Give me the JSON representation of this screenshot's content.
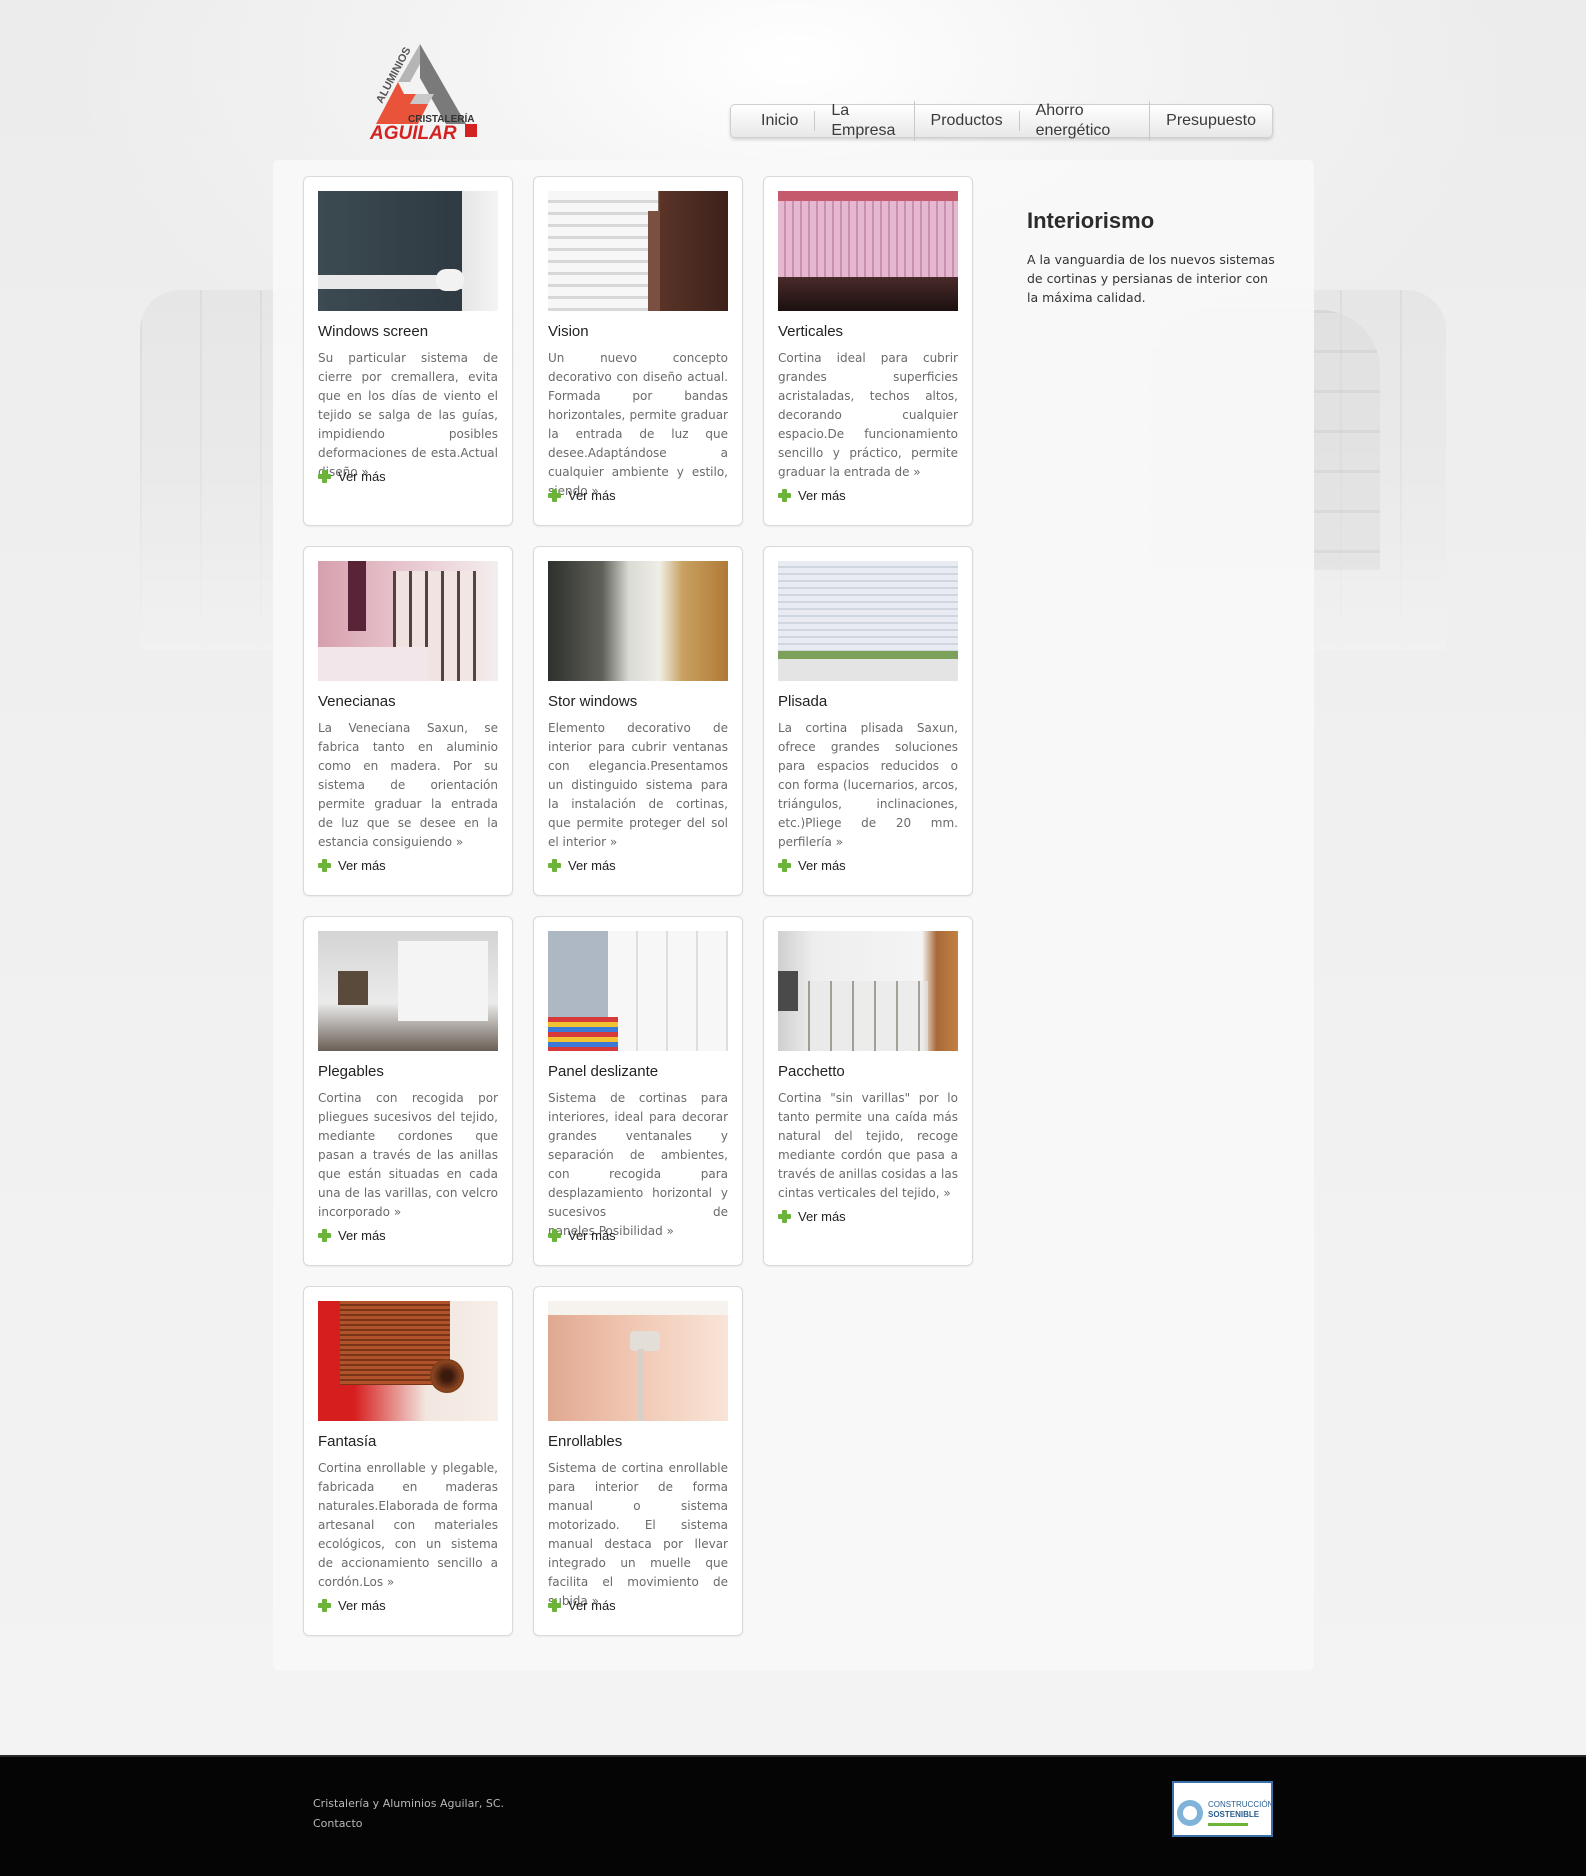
{
  "logo": {
    "line1": "ALUMINIOS",
    "line2": "CRISTALERÍA",
    "line3": "AGUILAR"
  },
  "nav": {
    "items": [
      "Inicio",
      "La Empresa",
      "Productos",
      "Ahorro energético",
      "Presupuesto"
    ]
  },
  "sidebar": {
    "title": "Interiorismo",
    "text": "A la vanguardia de los nuevos sistemas de cortinas y persianas de interior con la máxima calidad."
  },
  "more_label": "Ver más",
  "products": [
    {
      "title": "Windows screen",
      "text": "Su particular sistema de cierre por cremallera, evita que en los días de viento el tejido se salga de las guías, impidiendo posibles deformaciones de esta.Actual diseño »"
    },
    {
      "title": "Vision",
      "text": "Un nuevo concepto decorativo con diseño actual. Formada por bandas horizontales, permite graduar la entrada de luz que desee.Adaptándose a cualquier ambiente y estilo, siendo »"
    },
    {
      "title": "Verticales",
      "text": "Cortina ideal para cubrir grandes superficies acristaladas, techos altos, decorando cualquier espacio.De funcionamiento sencillo y práctico, permite graduar la entrada de »"
    },
    {
      "title": "Venecianas",
      "text": "La Veneciana Saxun, se fabrica tanto en aluminio como en madera. Por su sistema de orientación permite graduar la entrada de luz que se desee en la estancia consiguiendo »"
    },
    {
      "title": "Stor windows",
      "text": "Elemento decorativo de interior para cubrir ventanas con elegancia.Presentamos un distinguido sistema para la instalación de cortinas, que permite proteger del sol el interior »"
    },
    {
      "title": "Plisada",
      "text": "La cortina plisada Saxun, ofrece grandes soluciones para espacios reducidos o con forma (lucernarios, arcos, triángulos, inclinaciones, etc.)Pliege de 20 mm. perfilería »"
    },
    {
      "title": "Plegables",
      "text": "Cortina con recogida por pliegues sucesivos del tejido, mediante cordones que pasan a través de las anillas que están situadas en cada una de las varillas, con velcro incorporado »"
    },
    {
      "title": "Panel deslizante",
      "text": "Sistema de cortinas para interiores, ideal para decorar grandes ventanales y separación de ambientes, con recogida para desplazamiento horizontal y sucesivos de paneles.Posibilidad »"
    },
    {
      "title": "Pacchetto",
      "text": "Cortina \"sin varillas\" por lo tanto permite una caída más natural del tejido, recoge mediante cordón que pasa a través de anillas cosidas a las cintas verticales del tejido, »"
    },
    {
      "title": "Fantasía",
      "text": "Cortina enrollable y plegable, fabricada en maderas naturales.Elaborada de forma artesanal con materiales ecológicos, con un sistema de accionamiento sencillo a cordón.Los »"
    },
    {
      "title": "Enrollables",
      "text": "Sistema de cortina enrollable para interior de forma manual o sistema motorizado. El sistema manual destaca por llevar integrado un muelle que facilita el movimiento de subida »"
    }
  ],
  "footer": {
    "company": "Cristalería y Aluminios Aguilar, SC.",
    "contact": "Contacto",
    "badge_line1": "CONSTRUCCIÓN",
    "badge_line2": "SOSTENIBLE"
  }
}
